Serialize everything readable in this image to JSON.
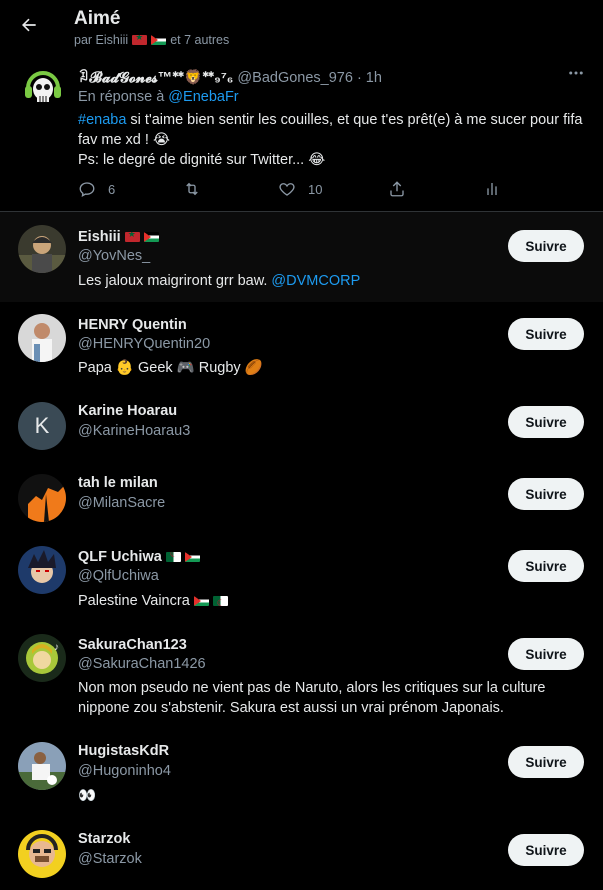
{
  "header": {
    "title": "Aimé",
    "subtitle_prefix": "par Eishiii",
    "subtitle_suffix": "et 7 autres"
  },
  "tweet": {
    "author_name": "ꀣ𝓑𝓪𝓭𝓖𝓸𝓷𝓮𝓼™ᕯ🦁ᕯ₉⁷₆",
    "author_handle": "@BadGones_976",
    "time": "· 1h",
    "reply_prefix": "En réponse à",
    "reply_to": "@EnebaFr",
    "hashtag": "#enaba",
    "text_line1": " si t'aime bien sentir les couilles, et que t'es prêt(e) à me sucer pour fifa fav me xd ! 😭",
    "text_line2": "Ps: le degré de dignité sur Twitter... 😂",
    "reply_count": "6",
    "like_count": "10"
  },
  "users": [
    {
      "name": "Eishiii",
      "handle": "@YovNes_",
      "bio": "Les jaloux maigriront grr baw. ",
      "bio_link": "@DVMCORP",
      "flags": [
        "ma",
        "ps"
      ],
      "button": "Suivre"
    },
    {
      "name": "HENRY Quentin",
      "handle": "@HENRYQuentin20",
      "bio": "Papa 👶 Geek 🎮 Rugby 🏉",
      "flags": [],
      "button": "Suivre"
    },
    {
      "name": "Karine Hoarau",
      "handle": "@KarineHoarau3",
      "avatar_letter": "K",
      "bio": "",
      "flags": [],
      "button": "Suivre"
    },
    {
      "name": "tah le milan",
      "handle": "@MilanSacre",
      "bio": "",
      "flags": [],
      "button": "Suivre"
    },
    {
      "name": "QLF Uchiwa",
      "handle": "@QlfUchiwa",
      "bio": "Palestine Vaincra",
      "flags": [
        "dz",
        "ps"
      ],
      "bio_flags": [
        "ps",
        "dz"
      ],
      "button": "Suivre"
    },
    {
      "name": "SakuraChan123",
      "handle": "@SakuraChan1426",
      "bio": "Non mon pseudo ne vient pas de Naruto, alors les critiques sur la culture nippone zou s'abstenir. Sakura est aussi un vrai prénom Japonais.",
      "flags": [],
      "button": "Suivre"
    },
    {
      "name": "HugistasKdR",
      "handle": "@Hugoninho4",
      "bio": "👀",
      "flags": [],
      "button": "Suivre"
    },
    {
      "name": "Starzok",
      "handle": "@Starzok",
      "bio": "",
      "flags": [],
      "button": "Suivre"
    }
  ],
  "colors": {
    "background": "#000000",
    "text": "#e7e9ea",
    "muted": "#8b98a5",
    "link": "#1d9bf0",
    "button_bg": "#eff3f4"
  }
}
